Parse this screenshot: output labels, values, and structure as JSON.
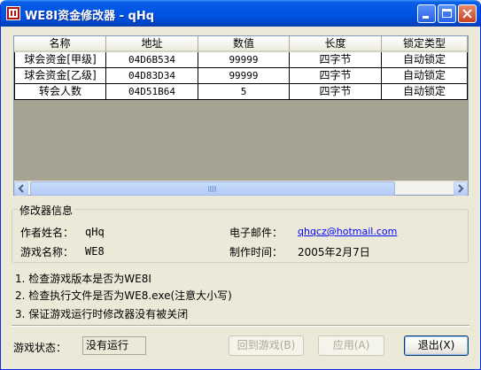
{
  "window": {
    "title": "WE8I资金修改器 - qHq"
  },
  "table": {
    "columns": [
      "名称",
      "地址",
      "数值",
      "长度",
      "锁定类型"
    ],
    "rows": [
      {
        "name": "球会资金[甲级]",
        "address": "04D6B534",
        "value": "99999",
        "length": "四字节",
        "lock": "自动锁定"
      },
      {
        "name": "球会资金[乙级]",
        "address": "04D83D34",
        "value": "99999",
        "length": "四字节",
        "lock": "自动锁定"
      },
      {
        "name": "转会人数",
        "address": "04D51B64",
        "value": "5",
        "length": "四字节",
        "lock": "自动锁定"
      }
    ]
  },
  "info": {
    "group_title": "修改器信息",
    "author_label": "作者姓名：",
    "author": "qHq",
    "email_label": "电子邮件：",
    "email": "qhqcz@hotmail.com",
    "game_label": "游戏名称：",
    "game": "WE8",
    "date_label": "制作时间：",
    "date": "2005年2月7日"
  },
  "notes": [
    "1. 检查游戏版本是否为WE8I",
    "2. 检查执行文件是否为WE8.exe(注意大小写)",
    "3. 保证游戏运行时修改器没有被关闭"
  ],
  "status": {
    "label": "游戏状态：",
    "value": "没有运行"
  },
  "buttons": {
    "back": "回到游戏(B)",
    "apply": "应用(A)",
    "exit": "退出(X)"
  }
}
